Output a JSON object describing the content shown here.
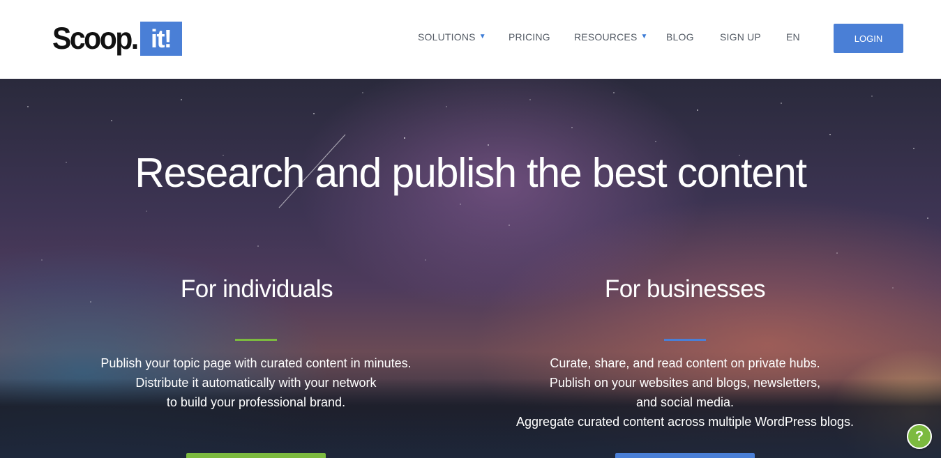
{
  "header": {
    "logo": {
      "word": "Scoop.",
      "badge": "it!"
    },
    "nav": [
      {
        "label": "SOLUTIONS",
        "has_caret": true
      },
      {
        "label": "PRICING",
        "has_caret": false
      },
      {
        "label": "RESOURCES",
        "has_caret": true
      },
      {
        "label": "BLOG",
        "has_caret": false
      },
      {
        "label": "SIGN UP",
        "has_caret": false
      },
      {
        "label": "EN",
        "has_caret": false
      }
    ],
    "caret_glyph": "▼",
    "login_label": "LOGIN"
  },
  "hero": {
    "title": "Research and publish the best content",
    "individuals": {
      "title": "For individuals",
      "lines": [
        "Publish your topic page with curated content in minutes.",
        "Distribute it automatically with your network",
        "to build your professional brand."
      ],
      "accent_color": "#7cba3f"
    },
    "businesses": {
      "title": "For businesses",
      "lines": [
        "Curate, share, and read content on private hubs.",
        "Publish on your websites and blogs, newsletters,",
        "and social media.",
        "Aggregate curated content across multiple WordPress blogs."
      ],
      "accent_color": "#4a7fd6"
    }
  },
  "help": {
    "label": "?",
    "icon": "question-icon"
  },
  "colors": {
    "brand_blue": "#4a7fd6",
    "brand_green": "#7cba3f",
    "nav_text": "#555c66"
  }
}
